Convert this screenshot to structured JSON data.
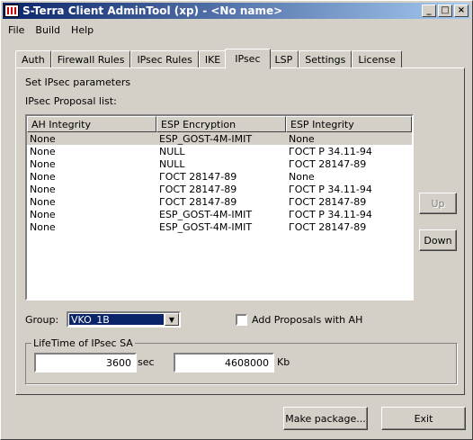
{
  "window": {
    "title": "S-Terra Client AdminTool (xp) - <No name>",
    "controls": {
      "minimize": "_",
      "maximize": "□",
      "close": "×"
    }
  },
  "menu": [
    "File",
    "Build",
    "Help"
  ],
  "tabs": [
    "Auth",
    "Firewall Rules",
    "IPsec Rules",
    "IKE",
    "IPsec",
    "LSP",
    "Settings",
    "License"
  ],
  "active_tab": "IPsec",
  "panel": {
    "set_label": "Set IPsec parameters",
    "list_label": "IPsec Proposal list:",
    "columns": [
      "AH Integrity",
      "ESP Encryption",
      "ESP Integrity"
    ],
    "rows": [
      [
        "None",
        "ESP_GOST-4M-IMIT",
        "None"
      ],
      [
        "None",
        "NULL",
        "ГОСТ Р 34.11-94"
      ],
      [
        "None",
        "NULL",
        "ГОСТ 28147-89"
      ],
      [
        "None",
        "ГОСТ 28147-89",
        "None"
      ],
      [
        "None",
        "ГОСТ 28147-89",
        "ГОСТ Р 34.11-94"
      ],
      [
        "None",
        "ГОСТ 28147-89",
        "ГОСТ 28147-89"
      ],
      [
        "None",
        "ESP_GOST-4M-IMIT",
        "ГОСТ Р 34.11-94"
      ],
      [
        "None",
        "ESP_GOST-4M-IMIT",
        "ГОСТ 28147-89"
      ]
    ],
    "selected_row": 0,
    "up_label": "Up",
    "down_label": "Down",
    "group_label": "Group:",
    "group_value": "VKO_1B",
    "add_ah_label": "Add Proposals with AH",
    "lifetime_title": "LifeTime of IPsec SA",
    "lifetime_sec": "3600",
    "sec_unit": "sec",
    "lifetime_kb": "4608000",
    "kb_unit": "Kb"
  },
  "footer": {
    "make_package_label": "Make package...",
    "exit_label": "Exit"
  }
}
